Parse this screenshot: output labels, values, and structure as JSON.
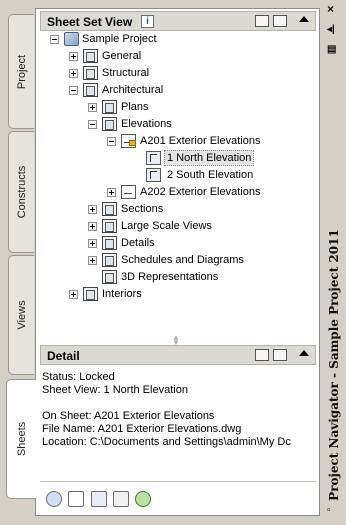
{
  "left_tabs": {
    "project": "Project",
    "constructs": "Constructs",
    "views": "Views",
    "sheets": "Sheets"
  },
  "sheet_set_view": {
    "title": "Sheet Set View",
    "info_badge": "i",
    "tree": {
      "root": "Sample Project",
      "general": "General",
      "structural": "Structural",
      "architectural": "Architectural",
      "plans": "Plans",
      "elevations": "Elevations",
      "a201": "A201 Exterior Elevations",
      "north": "1 North Elevation",
      "south": "2 South Elevation",
      "a202": "A202 Exterior Elevations",
      "sections": "Sections",
      "large_scale": "Large Scale Views",
      "details": "Details",
      "schedules": "Schedules and Diagrams",
      "representations": "3D Representations",
      "interiors": "Interiors"
    }
  },
  "detail": {
    "title": "Detail",
    "status": "Status: Locked",
    "sheet_view": "Sheet View: 1 North Elevation",
    "on_sheet": "On Sheet: A201 Exterior Elevations",
    "file_name": "File Name: A201 Exterior Elevations.dwg",
    "location": "Location: C:\\Documents and Settings\\admin\\My Dc"
  },
  "right_strip": {
    "close": "×",
    "title": "Project Navigator - Sample Project 2011"
  },
  "colors": {
    "panel_bg": "#d4d0c8",
    "header_bg": "#dcd9d2",
    "selection": "#e4e4e4"
  }
}
